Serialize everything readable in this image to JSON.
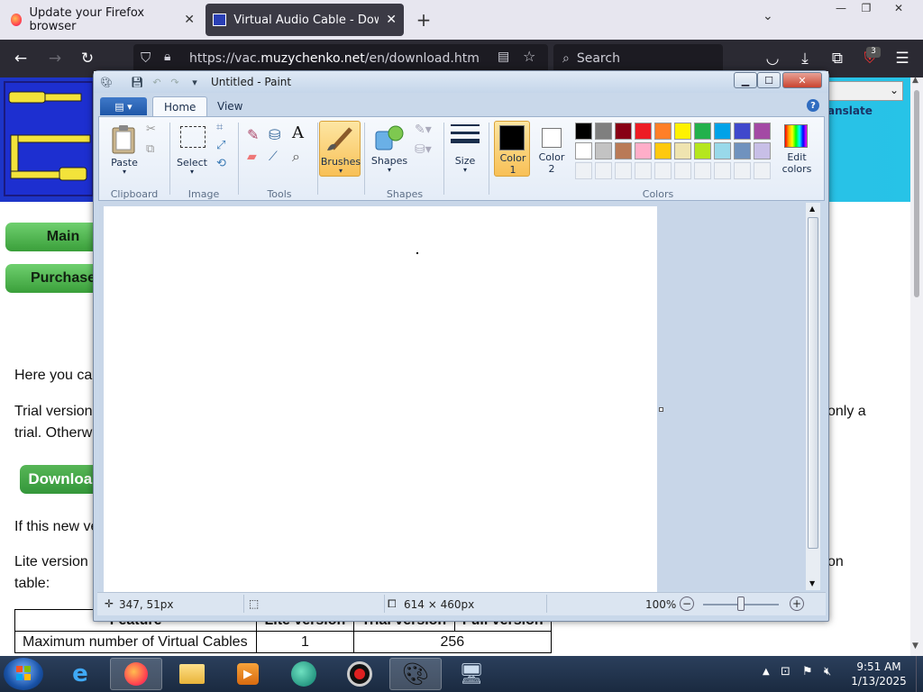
{
  "browser": {
    "tabs": [
      {
        "title": "Update your Firefox browser",
        "active": false
      },
      {
        "title": "Virtual Audio Cable - Downloa",
        "active": true
      }
    ],
    "url_prefix": "https://vac.",
    "url_domain": "muzychenko.net",
    "url_path": "/en/download.htm",
    "search_placeholder": "Search",
    "extension_badge": "3"
  },
  "webpage": {
    "nav_main": "Main",
    "nav_purchase": "Purchase",
    "translate_label": "anslate",
    "para1": "Here you ca",
    "para2a": "Trial version",
    "para2a_right": "only a",
    "para2b": "trial. Otherw",
    "download_button": "Download",
    "para3": "If this new ve",
    "para4a": "Lite version",
    "para4a_right": "on",
    "para4b": "table:",
    "table": {
      "headers": [
        "Feature",
        "Lite version",
        "Trial version",
        "Full version"
      ],
      "rows": [
        [
          "Maximum number of Virtual Cables",
          "1",
          "256"
        ]
      ]
    }
  },
  "paint": {
    "title": "Untitled - Paint",
    "tabs": {
      "home": "Home",
      "view": "View"
    },
    "ribbon": {
      "clipboard": {
        "paste": "Paste",
        "group": "Clipboard"
      },
      "image": {
        "select": "Select",
        "group": "Image"
      },
      "tools": {
        "group": "Tools"
      },
      "brushes": "Brushes",
      "shapes": {
        "label": "Shapes",
        "group": "Shapes"
      },
      "size": "Size",
      "color1": "Color\n1",
      "color2": "Color\n2",
      "colors_group": "Colors",
      "edit_colors": "Edit\ncolors",
      "palette_row1": [
        "#000000",
        "#7f7f7f",
        "#880015",
        "#ed1c24",
        "#ff7f27",
        "#fff200",
        "#22b14c",
        "#00a2e8",
        "#3f48cc",
        "#a349a4"
      ],
      "palette_row2": [
        "#ffffff",
        "#c3c3c3",
        "#b97a57",
        "#ffaec9",
        "#ffc90e",
        "#efe4b0",
        "#b5e61d",
        "#99d9ea",
        "#7092be",
        "#c8bfe7"
      ]
    },
    "status": {
      "cursor_pos": "347, 51px",
      "canvas_size": "614 × 460px",
      "zoom": "100%"
    }
  },
  "taskbar": {
    "time": "9:51 AM",
    "date": "1/13/2025"
  }
}
